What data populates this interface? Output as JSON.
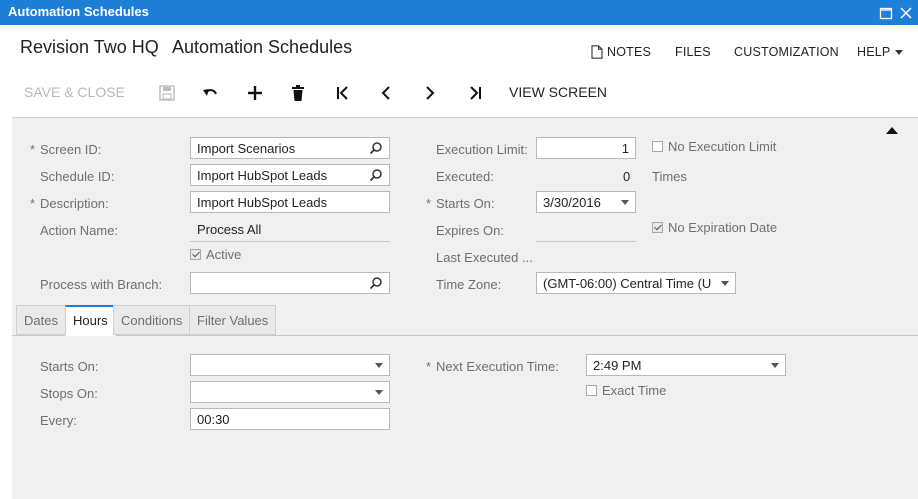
{
  "window": {
    "title": "Automation Schedules"
  },
  "header": {
    "company": "Revision Two HQ",
    "screen_title": "Automation Schedules"
  },
  "top_menu": {
    "notes": "NOTES",
    "files": "FILES",
    "customization": "CUSTOMIZATION",
    "help": "HELP"
  },
  "toolbar": {
    "save_close": "SAVE & CLOSE",
    "view_screen": "VIEW SCREEN"
  },
  "form": {
    "screen_id": {
      "label": "Screen ID:",
      "value": "Import Scenarios"
    },
    "schedule_id": {
      "label": "Schedule ID:",
      "value": "Import HubSpot Leads"
    },
    "description": {
      "label": "Description:",
      "value": "Import HubSpot Leads"
    },
    "action_name": {
      "label": "Action Name:",
      "value": "Process All"
    },
    "active": {
      "label": "Active",
      "checked": true
    },
    "process_with_branch": {
      "label": "Process with Branch:",
      "value": ""
    },
    "execution_limit": {
      "label": "Execution Limit:",
      "value": "1"
    },
    "no_execution_limit": {
      "label": "No Execution Limit",
      "checked": false
    },
    "executed": {
      "label": "Executed:",
      "value": "0",
      "unit": "Times"
    },
    "starts_on": {
      "label": "Starts On:",
      "value": "3/30/2016"
    },
    "expires_on": {
      "label": "Expires On:",
      "value": ""
    },
    "no_expiration_date": {
      "label": "No Expiration Date",
      "checked": true
    },
    "last_executed": {
      "label": "Last Executed ...",
      "value": ""
    },
    "time_zone": {
      "label": "Time Zone:",
      "value": "(GMT-06:00) Central Time (U"
    }
  },
  "tabs": [
    {
      "label": "Dates"
    },
    {
      "label": "Hours"
    },
    {
      "label": "Conditions"
    },
    {
      "label": "Filter Values"
    }
  ],
  "hours": {
    "starts_on": {
      "label": "Starts On:",
      "value": ""
    },
    "stops_on": {
      "label": "Stops On:",
      "value": ""
    },
    "every": {
      "label": "Every:",
      "value": "00:30"
    },
    "next_execution_time": {
      "label": "Next Execution Time:",
      "value": "2:49 PM"
    },
    "exact_time": {
      "label": "Exact Time",
      "checked": false
    }
  },
  "colors": {
    "accent": "#1e7fd6",
    "panel": "#f0f0f0",
    "label": "#6f6f6f"
  },
  "icons": [
    "maximize-icon",
    "close-icon",
    "notes-icon",
    "save-icon",
    "undo-icon",
    "add-icon",
    "delete-icon",
    "first-icon",
    "prev-icon",
    "next-icon",
    "last-icon",
    "collapse-icon",
    "search-icon",
    "dropdown-icon",
    "checkbox-icon"
  ]
}
